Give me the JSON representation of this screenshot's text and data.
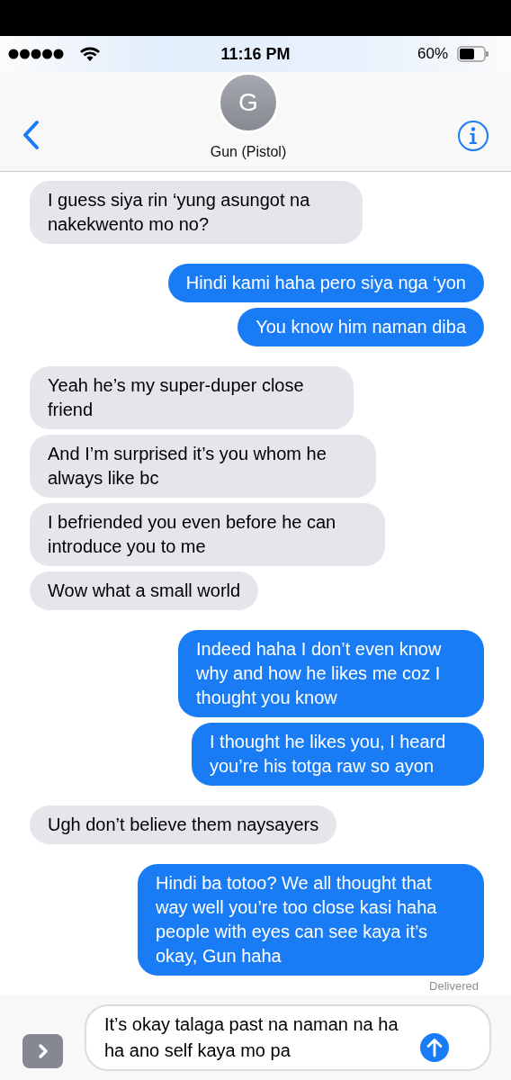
{
  "status_bar": {
    "time": "11:16 PM",
    "battery": "60%"
  },
  "contact": {
    "initial": "G",
    "name": "Gun (Pistol)"
  },
  "messages": [
    {
      "kind": "incoming",
      "text": "I guess siya rin ‘yung asungot na nakekwento mo no?"
    },
    {
      "kind": "outgoing",
      "text": "Hindi kami haha pero siya nga ‘yon"
    },
    {
      "kind": "outgoing",
      "text": "You know him naman diba"
    },
    {
      "kind": "incoming",
      "text": "Yeah he’s my super-duper close friend"
    },
    {
      "kind": "incoming",
      "text": "And I’m surprised it’s you whom he always like bc"
    },
    {
      "kind": "incoming",
      "text": "I befriended you even before he can introduce you to me"
    },
    {
      "kind": "incoming",
      "text": "Wow what a small world"
    },
    {
      "kind": "outgoing",
      "text": "Indeed haha I don’t even know why and how he likes me coz I thought you know"
    },
    {
      "kind": "outgoing",
      "text": "I thought he likes you, I heard you’re his totga raw so ayon"
    },
    {
      "kind": "incoming",
      "text": "Ugh don’t believe them naysayers"
    },
    {
      "kind": "outgoing",
      "text": "Hindi ba totoo? We all thought that way well you’re too close kasi haha people with eyes can see kaya it’s okay, Gun haha"
    }
  ],
  "receipt": "Delivered",
  "composer": {
    "value": "It’s okay talaga past na naman na ha ha ano self kaya mo pa"
  }
}
